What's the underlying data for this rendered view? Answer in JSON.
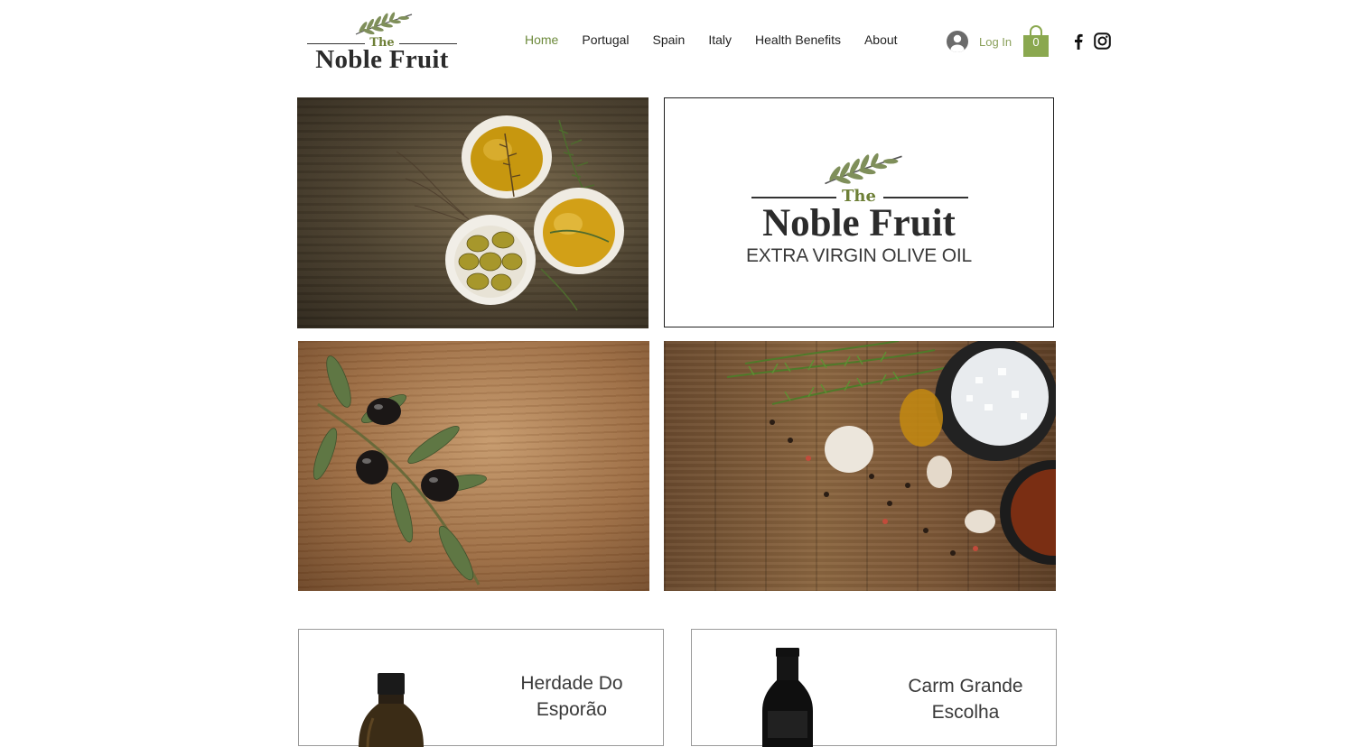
{
  "header": {
    "logo": {
      "the": "The",
      "name": "Noble Fruit"
    },
    "nav": [
      {
        "label": "Home",
        "active": true
      },
      {
        "label": "Portugal",
        "active": false
      },
      {
        "label": "Spain",
        "active": false
      },
      {
        "label": "Italy",
        "active": false
      },
      {
        "label": "Health Benefits",
        "active": false
      },
      {
        "label": "About",
        "active": false
      }
    ],
    "login_label": "Log In",
    "cart_count": "0",
    "social": [
      "facebook-icon",
      "instagram-icon"
    ]
  },
  "gallery": {
    "logo_tile": {
      "the": "The",
      "name": "Noble Fruit",
      "subtitle": "EXTRA VIRGIN OLIVE OIL"
    }
  },
  "products": [
    {
      "title_line1": "Herdade Do",
      "title_line2": "Esporão"
    },
    {
      "title_line1": "Carm Grande",
      "title_line2": "Escolha"
    }
  ],
  "colors": {
    "accent_green": "#6d8a3c",
    "cart_green": "#8aa84f",
    "text": "#1a1a1a"
  }
}
